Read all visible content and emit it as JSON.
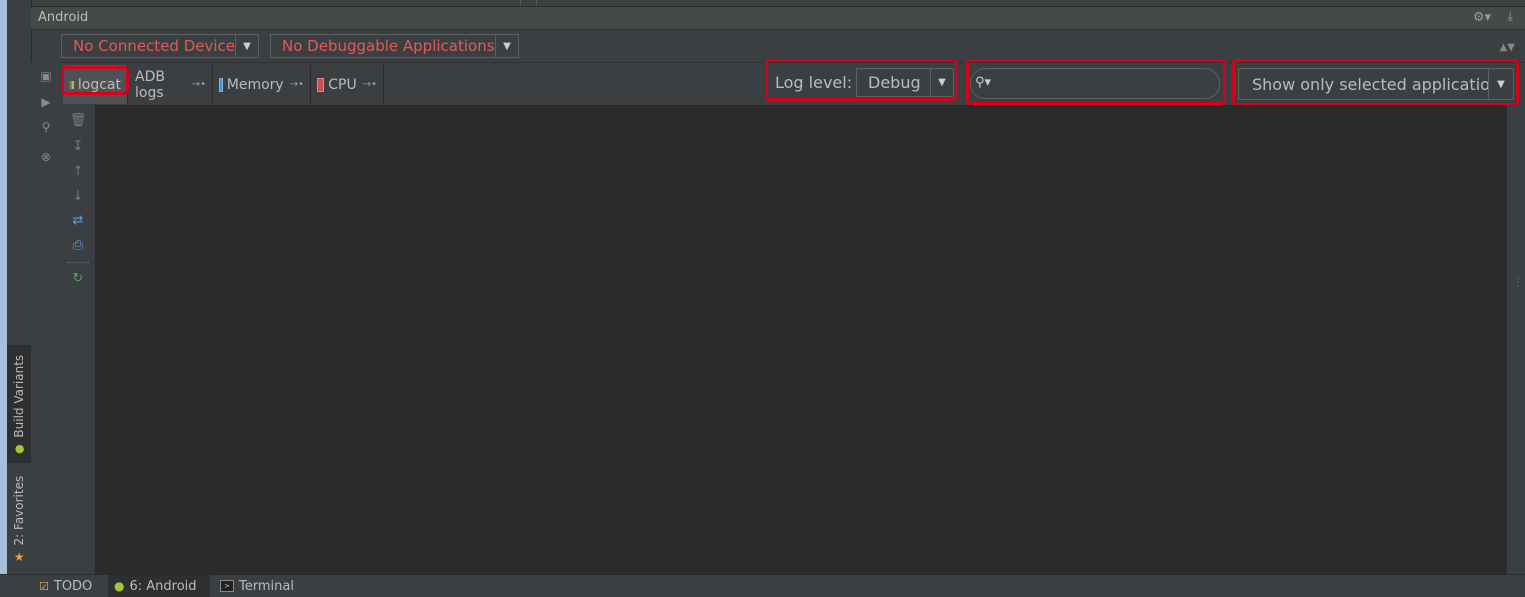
{
  "panel": {
    "title": "Android"
  },
  "device_selector": {
    "value": "No Connected Device"
  },
  "app_selector": {
    "value": "No Debuggable Applications"
  },
  "tabs": [
    {
      "label": "logcat",
      "icon": "logcat-icon",
      "active": true
    },
    {
      "label": "ADB logs",
      "icon": "",
      "active": false
    },
    {
      "label": "Memory",
      "icon": "memory-chart-icon",
      "active": false
    },
    {
      "label": "CPU",
      "icon": "cpu-chart-icon",
      "active": false
    }
  ],
  "log_level": {
    "label": "Log level:",
    "value": "Debug"
  },
  "search": {
    "value": "",
    "placeholder": ""
  },
  "filter": {
    "value": "Show only selected application"
  },
  "side_tabs": [
    {
      "label": "Build Variants"
    },
    {
      "label": "2: Favorites"
    }
  ],
  "bottom_tabs": [
    {
      "label": "TODO"
    },
    {
      "label": "6: Android"
    },
    {
      "label": "Terminal"
    }
  ],
  "colors": {
    "error_text": "#e05a5a",
    "highlight_box": "#d6001c",
    "console_bg": "#2b2b2b",
    "panel_bg": "#3c3f41"
  }
}
